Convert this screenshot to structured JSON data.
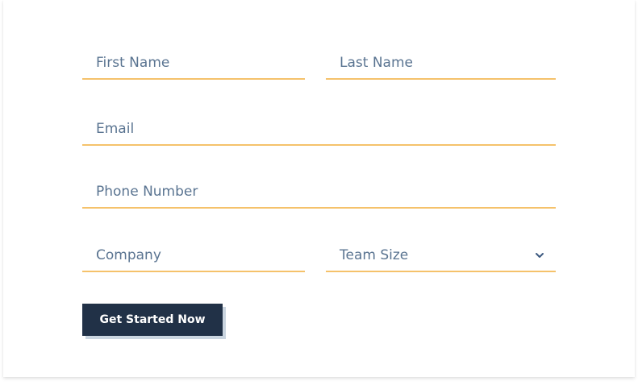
{
  "form": {
    "first_name": {
      "placeholder": "First Name",
      "value": ""
    },
    "last_name": {
      "placeholder": "Last Name",
      "value": ""
    },
    "email": {
      "placeholder": "Email",
      "value": ""
    },
    "phone": {
      "placeholder": "Phone Number",
      "value": ""
    },
    "company": {
      "placeholder": "Company",
      "value": ""
    },
    "team_size": {
      "selected": "Team Size",
      "icon": "chevron-down-icon"
    },
    "submit_label": "Get Started Now"
  },
  "colors": {
    "underline": "#f5c26b",
    "placeholder_text": "#5a7491",
    "button_bg": "#213147",
    "button_text": "#ffffff",
    "button_shadow": "#cad5e0",
    "chevron": "#3d5a80"
  }
}
